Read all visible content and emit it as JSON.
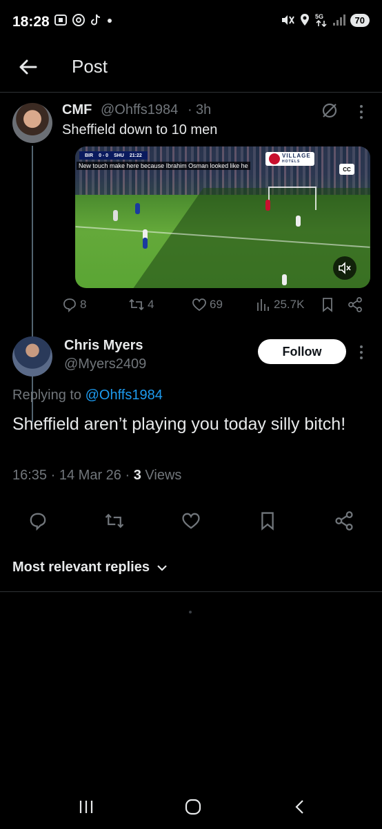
{
  "status_bar": {
    "time": "18:28",
    "battery": "70",
    "left_icons": [
      "screen-record-icon",
      "at-sign-icon",
      "tiktok-icon",
      "notification-dot-icon"
    ],
    "right_icons": [
      "mute-vibrate-icon",
      "location-icon",
      "5g-icon",
      "signal-icon"
    ],
    "network": "5G"
  },
  "header": {
    "title": "Post"
  },
  "parent_post": {
    "name": "CMF",
    "handle": "@Ohffs1984",
    "separator": "·",
    "time": "3h",
    "text": "Sheffield down to 10 men",
    "video": {
      "score_home": "BIR",
      "score": "0 - 0",
      "score_away": "SHU",
      "clock": "21:22",
      "subtitle": "New touch make here because Ibrahim Osman looked like he",
      "sponsor": "VILLAGE",
      "sponsor_sub": "HOTELS",
      "cc_label": "CC"
    },
    "stats": {
      "replies": "8",
      "reposts": "4",
      "likes": "69",
      "views": "25.7K"
    }
  },
  "focused_post": {
    "name": "Chris Myers",
    "handle": "@Myers2409",
    "follow_label": "Follow",
    "replying_prefix": "Replying to",
    "replying_to": "@Ohffs1984",
    "text": "Sheffield aren’t playing you today silly bitch!",
    "time": "16:35",
    "date": "14 Mar 26",
    "views_count": "3",
    "views_label": "Views",
    "sep": "·"
  },
  "replies_sort": {
    "label": "Most relevant replies"
  },
  "colors": {
    "background": "#000000",
    "text_primary": "#e7e9ea",
    "text_secondary": "#71767b",
    "accent": "#1d9bf0",
    "divider": "#2f3336"
  }
}
